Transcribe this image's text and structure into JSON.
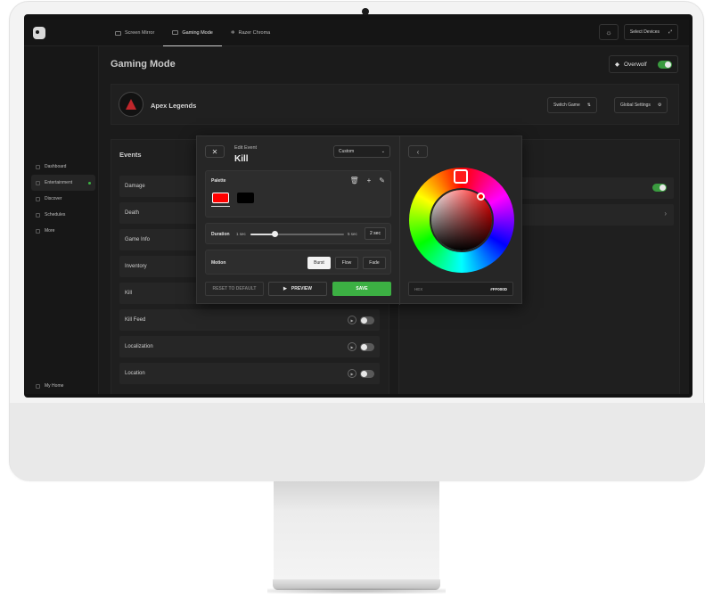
{
  "tabs": [
    {
      "label": "Screen Mirror",
      "icon": "monitor-icon"
    },
    {
      "label": "Gaming Mode",
      "icon": "gamepad-icon"
    },
    {
      "label": "Razer Chroma",
      "icon": "sparkle-icon"
    }
  ],
  "top": {
    "devices_label": "Select Devices",
    "brightness_icon": "sun-icon"
  },
  "sidebar": {
    "items": [
      {
        "label": "Dashboard"
      },
      {
        "label": "Entertainment",
        "active": true
      },
      {
        "label": "Discover"
      },
      {
        "label": "Schedules"
      },
      {
        "label": "More"
      }
    ],
    "home_label": "My Home"
  },
  "page": {
    "title": "Gaming Mode"
  },
  "overwolf": {
    "label": "Overwolf",
    "enabled": true
  },
  "game": {
    "name": "Apex Legends",
    "switch_label": "Switch Game",
    "settings_label": "Global Settings"
  },
  "events": {
    "title": "Events",
    "rows": [
      "Damage",
      "Death",
      "Game Info",
      "Inventory",
      "Kill",
      "Kill Feed",
      "Localization",
      "Location"
    ]
  },
  "modal": {
    "subtitle": "Edit Event",
    "title": "Kill",
    "preset": "Custom",
    "palette_label": "Palette",
    "swatches": [
      "#FF0000",
      "#000000"
    ],
    "duration_label": "Duration",
    "duration_min": "1 sec",
    "duration_max": "5 sec",
    "duration_value": "2 sec",
    "motion_label": "Motion",
    "motion_options": [
      "Burst",
      "Flow",
      "Fade"
    ],
    "motion_selected": "Burst",
    "reset_label": "RESET TO DEFAULT",
    "preview_label": "PREVIEW",
    "save_label": "SAVE"
  },
  "picker": {
    "hex_label": "HEX",
    "hex_value": "#FF000D"
  },
  "colors": {
    "accent_green": "#3CB043",
    "apex_red": "#C0262B"
  }
}
